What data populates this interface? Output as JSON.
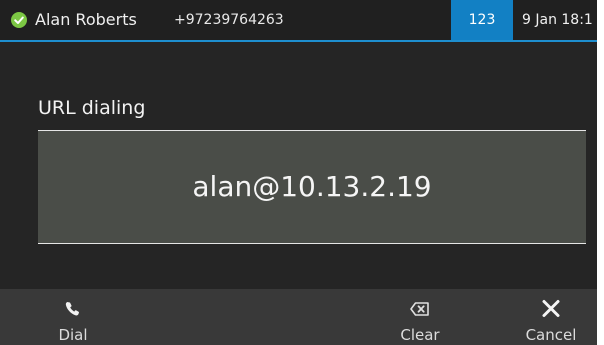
{
  "status_bar": {
    "user_name": "Alan Roberts",
    "phone_number": "+97239764263",
    "extension_badge": "123",
    "date_time": "9 Jan 18:1",
    "presence_color": "#7cc744",
    "accent_color": "#1e8fd0"
  },
  "main": {
    "title": "URL dialing",
    "url_value": "alan@10.13.2.19"
  },
  "softkeys": {
    "dial": {
      "label": "Dial",
      "icon": "phone-handset-icon"
    },
    "clear": {
      "label": "Clear",
      "icon": "backspace-icon"
    },
    "cancel": {
      "label": "Cancel",
      "icon": "close-icon"
    }
  }
}
